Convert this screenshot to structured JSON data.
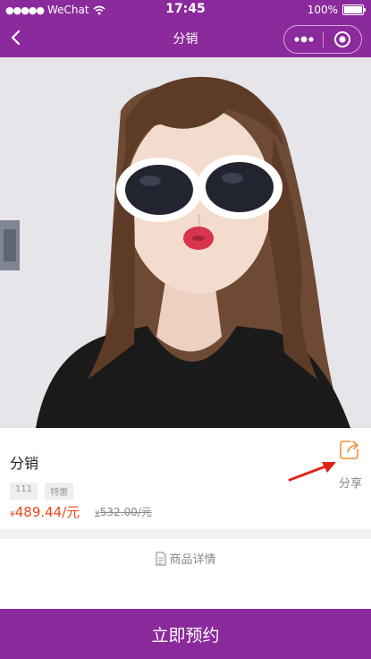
{
  "status": {
    "carrier": "WeChat",
    "time": "17:45",
    "battery": "100%"
  },
  "nav": {
    "title": "分销"
  },
  "product": {
    "name": "分销",
    "share_label": "分享",
    "tags": [
      "111",
      "特惠"
    ],
    "currency": "¥",
    "price": "489.44/元",
    "old_price": "532.00/元"
  },
  "details": {
    "title": "商品详情"
  },
  "footer": {
    "book_label": "立即预约"
  },
  "colors": {
    "brand": "#8b2a9c",
    "price": "#e8491d",
    "arrow": "#e0241a",
    "share_icon": "#f0913a"
  }
}
